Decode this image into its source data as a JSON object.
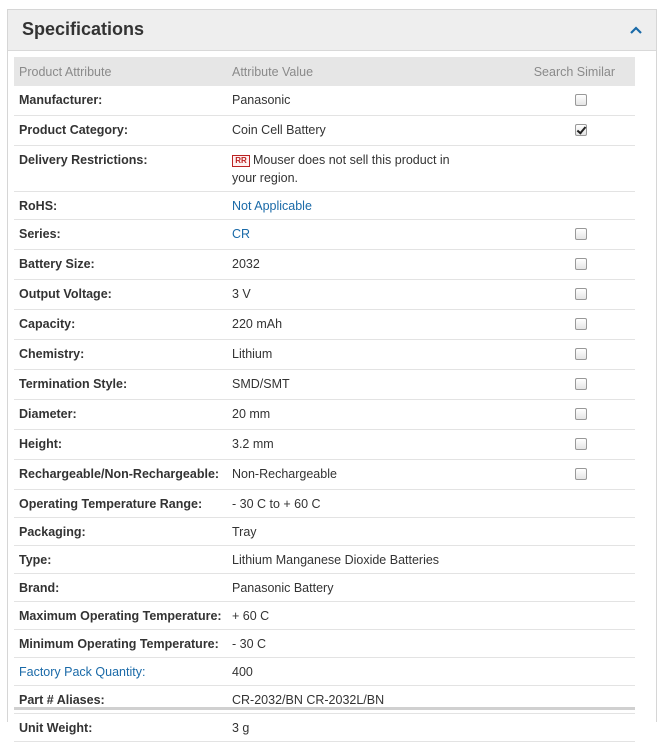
{
  "panel": {
    "title": "Specifications",
    "collapse_icon": "chevron-up-icon"
  },
  "table": {
    "headers": {
      "attribute": "Product Attribute",
      "value": "Attribute Value",
      "search": "Search Similar"
    },
    "rows": [
      {
        "attr": "Manufacturer:",
        "value": "Panasonic",
        "checkbox": "unchecked"
      },
      {
        "attr": "Product Category:",
        "value": "Coin Cell Battery",
        "checkbox": "checked"
      },
      {
        "attr": "Delivery Restrictions:",
        "value": "Mouser does not sell this product in your region.",
        "icon_text": "RR",
        "checkbox": "none"
      },
      {
        "attr": "RoHS:",
        "value": "Not Applicable",
        "value_link": true,
        "checkbox": "none"
      },
      {
        "attr": "Series:",
        "value": "CR",
        "value_link": true,
        "checkbox": "unchecked"
      },
      {
        "attr": "Battery Size:",
        "value": "2032",
        "checkbox": "unchecked"
      },
      {
        "attr": "Output Voltage:",
        "value": "3 V",
        "checkbox": "unchecked"
      },
      {
        "attr": "Capacity:",
        "value": "220 mAh",
        "checkbox": "unchecked"
      },
      {
        "attr": "Chemistry:",
        "value": "Lithium",
        "checkbox": "unchecked"
      },
      {
        "attr": "Termination Style:",
        "value": "SMD/SMT",
        "checkbox": "unchecked"
      },
      {
        "attr": "Diameter:",
        "value": "20 mm",
        "checkbox": "unchecked"
      },
      {
        "attr": "Height:",
        "value": "3.2 mm",
        "checkbox": "unchecked"
      },
      {
        "attr": "Rechargeable/Non-Rechargeable:",
        "value": "Non-Rechargeable",
        "checkbox": "unchecked"
      },
      {
        "attr": "Operating Temperature Range:",
        "value": "- 30 C to + 60 C",
        "checkbox": "none"
      },
      {
        "attr": "Packaging:",
        "value": "Tray",
        "checkbox": "none"
      },
      {
        "attr": "Type:",
        "value": "Lithium Manganese Dioxide Batteries",
        "checkbox": "none"
      },
      {
        "attr": "Brand:",
        "value": "Panasonic Battery",
        "checkbox": "none"
      },
      {
        "attr": "Maximum Operating Temperature:",
        "value": "+ 60 C",
        "checkbox": "none"
      },
      {
        "attr": "Minimum Operating Temperature:",
        "value": "- 30 C",
        "checkbox": "none"
      },
      {
        "attr": "Factory Pack Quantity:",
        "attr_link": true,
        "value": "400",
        "checkbox": "none"
      },
      {
        "attr": "Part # Aliases:",
        "value": "CR-2032/BN CR-2032L/BN",
        "checkbox": "none"
      },
      {
        "attr": "Unit Weight:",
        "value": "3 g",
        "checkbox": "none"
      }
    ]
  },
  "colors": {
    "link": "#1a6aa8",
    "header_bg": "#eeeeee",
    "table_header_bg": "#e6e6e6",
    "restriction_red": "#b22222"
  }
}
